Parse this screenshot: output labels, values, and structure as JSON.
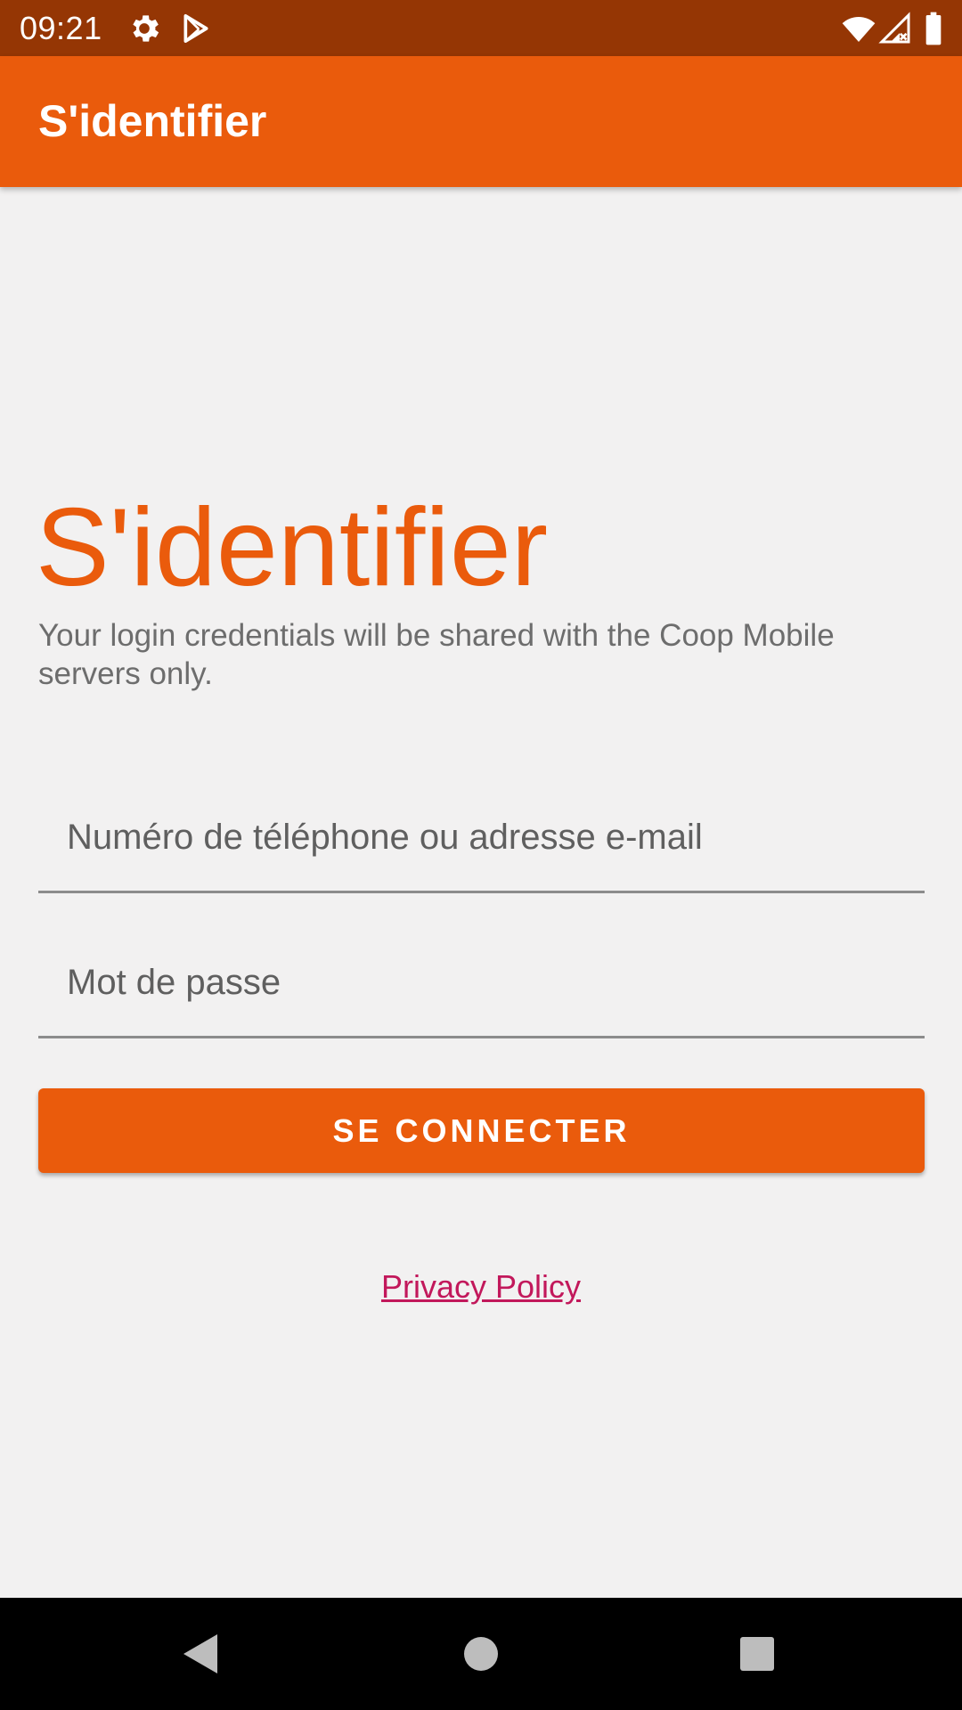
{
  "status_bar": {
    "time": "09:21",
    "icons": [
      "settings-icon",
      "play-store-icon",
      "wifi-icon",
      "signal-icon",
      "battery-icon"
    ]
  },
  "app_bar": {
    "title": "S'identifier"
  },
  "login": {
    "heading": "S'identifier",
    "description": "Your login credentials will be shared with the Coop Mobile servers only.",
    "login_placeholder": "Numéro de téléphone ou adresse e-mail",
    "password_placeholder": "Mot de passe",
    "connect_label": "SE CONNECTER",
    "privacy_label": "Privacy Policy"
  },
  "nav_bar": {
    "icons": [
      "back-icon",
      "home-icon",
      "recents-icon"
    ]
  },
  "colors": {
    "status_bar": "#953604",
    "accent": "#ea5b0c",
    "background": "#f2f1f1",
    "link": "#c2185b"
  }
}
